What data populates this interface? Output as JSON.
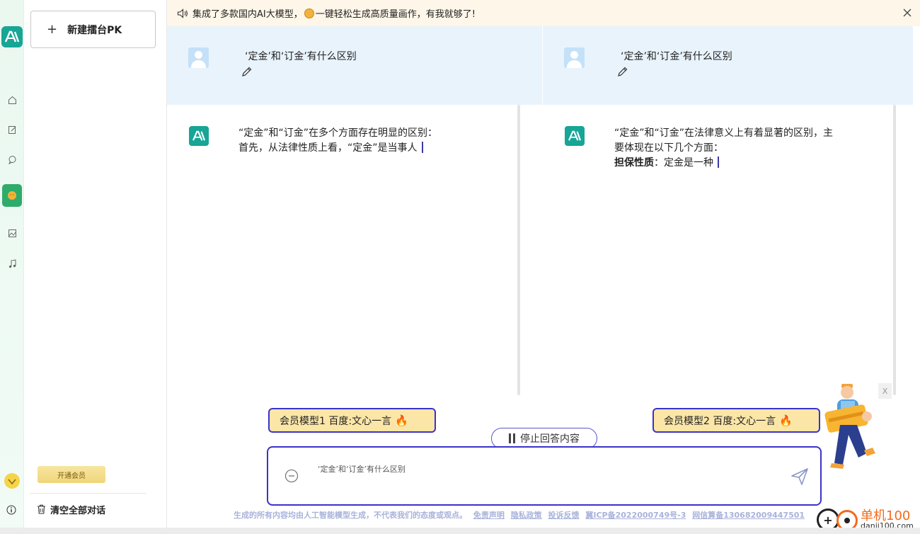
{
  "notice": {
    "text_part1": "集成了多款国内AI大模型，",
    "text_part2": "一键轻松生成高质量画作，有我就够了!"
  },
  "sidebar": {
    "new_button_label": "新建擂台PK",
    "vip_button_label": "开通会员",
    "clear_button_label": "清空全部对话"
  },
  "question": {
    "left": "‘定金’和‘订金’有什么区别",
    "right": "‘定金’和‘订金’有什么区别"
  },
  "answers": {
    "left": {
      "line1": "“定金”和“订金”在多个方面存在明显的区别：",
      "line2": "首先，从法律性质上看，“定金”是当事人"
    },
    "right": {
      "line1": "“定金”和“订金”在法律意义上有着显著的区别，主",
      "line2": "要体现在以下几个方面：",
      "line3_bold": "担保性质",
      "line3_rest": "：定金是一种"
    }
  },
  "models": {
    "left": "会员模型1 百度:文心一言",
    "right": "会员模型2 百度:文心一言",
    "flame": "🔥"
  },
  "stop_button_label": "停止回答内容",
  "input": {
    "value": "‘定金’和‘订金’有什么区别"
  },
  "footer": {
    "disclaimer": "生成的所有内容均由人工智能模型生成，不代表我们的态度或观点。",
    "links": [
      "免责声明",
      "隐私政策",
      "投诉反馈",
      "冀ICP备2022000749号-3",
      "网信算备130682009447501"
    ]
  },
  "mascot_close": "X",
  "watermark": {
    "title": "单机100网",
    "url": "danji100.com"
  },
  "colors": {
    "accent": "#3b33c9",
    "brand_teal": "#17a596",
    "badge_bg": "#fbe6a8",
    "question_bg": "#e9f3fc",
    "notice_bg": "#fdf6e9"
  }
}
